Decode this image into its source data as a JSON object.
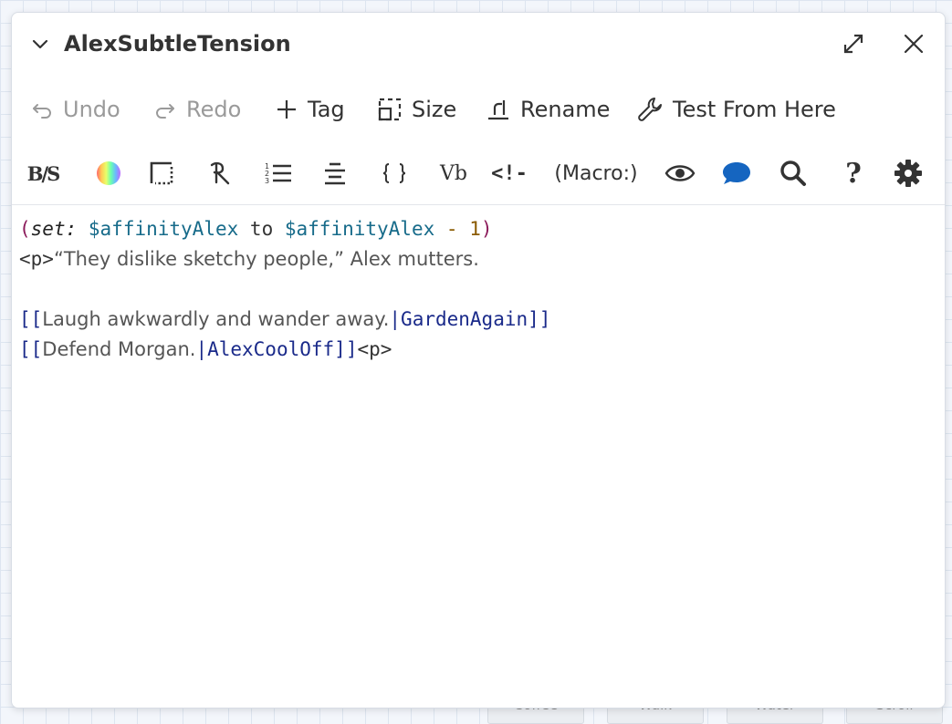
{
  "background_passages": [
    "Coffee",
    "Walk",
    "Water",
    "Scroll"
  ],
  "dialog": {
    "title": "AlexSubtleTension"
  },
  "toolbar": {
    "undo": "Undo",
    "redo": "Redo",
    "tag": "Tag",
    "size": "Size",
    "rename": "Rename",
    "test_from_here": "Test From Here"
  },
  "format_toolbar": {
    "bold_strike": "B/S",
    "vb": "Vb",
    "comment": "<!-",
    "macro": "(Macro:)",
    "help": "?"
  },
  "code": {
    "line1": {
      "open": "(",
      "keyword": "set:",
      "var1": "$affinityAlex",
      "to": "to",
      "var2": "$affinityAlex",
      "minus": "-",
      "num": "1",
      "close": ")"
    },
    "line2": {
      "tag": "<p>",
      "text": "“They dislike sketchy people,” Alex mutters."
    },
    "line4": {
      "open": "[[",
      "text": "Laugh awkwardly and wander away.",
      "bar": "|",
      "target": "GardenAgain",
      "close": "]]"
    },
    "line5": {
      "open": "[[",
      "text": "Defend Morgan.",
      "bar": "|",
      "target": "AlexCoolOff",
      "close": "]]",
      "tag": "<p>"
    }
  },
  "colors": {
    "accent_blue": "#1565c0"
  }
}
